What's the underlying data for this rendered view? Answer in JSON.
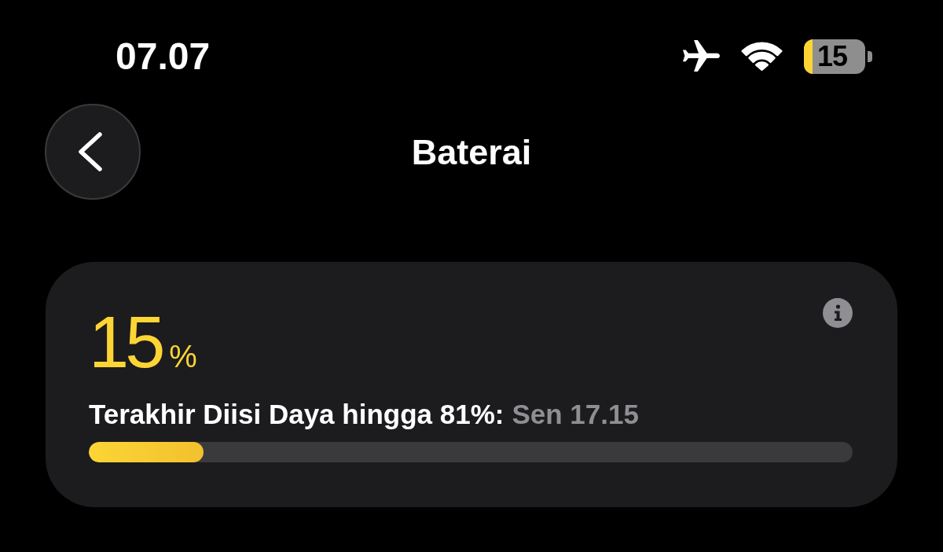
{
  "low_power_mode": true,
  "status_bar": {
    "time": "07.07",
    "airplane_mode": true,
    "battery_text": "15"
  },
  "nav": {
    "title": "Baterai"
  },
  "battery_card": {
    "percent": "15",
    "percent_sign": "%",
    "last_charged_label": "Terakhir Diisi Daya hingga 81%:",
    "last_charged_value": "Sen 17.15",
    "level": 0.15
  }
}
